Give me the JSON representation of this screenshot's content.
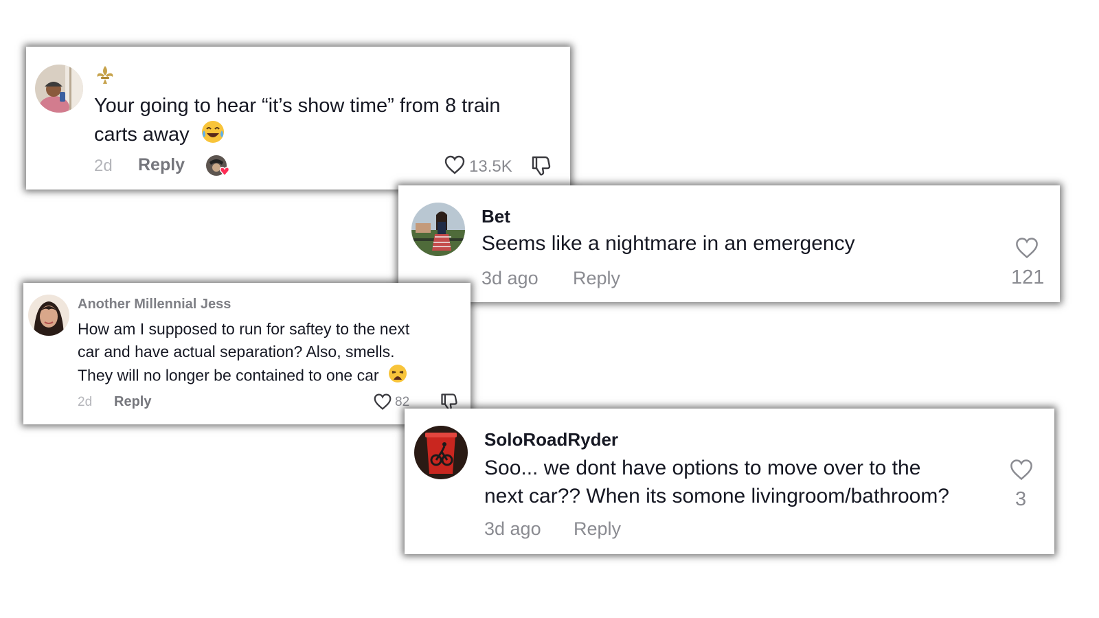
{
  "comments": [
    {
      "username": "",
      "text_line1": "Your going to hear “it’s show time” from 8 train",
      "text_line2": "carts away",
      "emoji": "laughing-tears",
      "time": "2d",
      "reply_label": "Reply",
      "likes": "13.5K",
      "badge_icon": "fleur-de-lis-icon"
    },
    {
      "username": "Bet",
      "text": "Seems like a nightmare in an emergency",
      "time": "3d ago",
      "reply_label": "Reply",
      "likes": "121"
    },
    {
      "username": "Another Millennial Jess",
      "text_line1": "How am I supposed to run for saftey to the next",
      "text_line2": "car and have actual separation? Also, smells.",
      "text_line3": "They will no longer be contained to one car",
      "emoji": "weary-face",
      "time": "2d",
      "reply_label": "Reply",
      "likes": "82"
    },
    {
      "username": "SoloRoadRyder",
      "text_line1": "Soo... we dont have options to move over to the",
      "text_line2": "next car?? When its somone livingroom/bathroom?",
      "time": "3d ago",
      "reply_label": "Reply",
      "likes": "3"
    }
  ],
  "colors": {
    "text": "#161823",
    "muted": "#8a8b91",
    "creator_like": "#fe2c55"
  }
}
